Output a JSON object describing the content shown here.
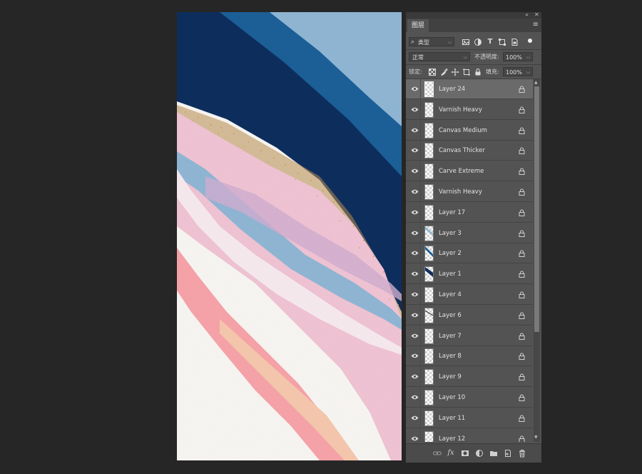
{
  "panel": {
    "collapse_glyph": "«",
    "close_glyph": "✕",
    "tab_label": "图层",
    "menu_glyph": "≡",
    "filter": {
      "value": "类型",
      "search_glyph": "⌕",
      "icons": [
        "image-filter-icon",
        "adjustment-filter-icon",
        "type-filter-icon",
        "shape-filter-icon",
        "smart-object-filter-icon",
        "filter-toggle-icon"
      ]
    },
    "blend_mode": "正常",
    "opacity_label": "不透明度:",
    "opacity_value": "100%",
    "lock_label": "锁定:",
    "fill_label": "填充:",
    "fill_value": "100%"
  },
  "layers": [
    {
      "name": "Layer 24",
      "selected": true,
      "thumb": "empty"
    },
    {
      "name": "Varnish Heavy",
      "selected": false,
      "thumb": "empty"
    },
    {
      "name": "Canvas Medium",
      "selected": false,
      "thumb": "empty"
    },
    {
      "name": "Canvas Thicker",
      "selected": false,
      "thumb": "empty"
    },
    {
      "name": "Carve Extreme",
      "selected": false,
      "thumb": "empty"
    },
    {
      "name": "Varnish Heavy",
      "selected": false,
      "thumb": "empty"
    },
    {
      "name": "Layer 17",
      "selected": false,
      "thumb": "empty"
    },
    {
      "name": "Layer 3",
      "selected": false,
      "thumb": "light-stroke"
    },
    {
      "name": "Layer 2",
      "selected": false,
      "thumb": "blue-stroke"
    },
    {
      "name": "Layer 1",
      "selected": false,
      "thumb": "navy-stroke"
    },
    {
      "name": "Layer 4",
      "selected": false,
      "thumb": "empty"
    },
    {
      "name": "Layer 6",
      "selected": false,
      "thumb": "dark-line"
    },
    {
      "name": "Layer 7",
      "selected": false,
      "thumb": "empty"
    },
    {
      "name": "Layer 8",
      "selected": false,
      "thumb": "empty"
    },
    {
      "name": "Layer 9",
      "selected": false,
      "thumb": "empty"
    },
    {
      "name": "Layer 10",
      "selected": false,
      "thumb": "empty"
    },
    {
      "name": "Layer 11",
      "selected": false,
      "thumb": "empty"
    },
    {
      "name": "Layer 12",
      "selected": false,
      "thumb": "empty"
    }
  ],
  "bottom_icons": [
    "link-icon",
    "fx-icon",
    "mask-icon",
    "adjustment-icon",
    "group-folder-icon",
    "new-layer-icon",
    "trash-icon"
  ],
  "colors": {
    "workspace": "#262626",
    "panel": "#535353",
    "selected_row": "#6a6a6a",
    "navy": "#0f2f5e",
    "blue": "#1a5f98",
    "light_blue": "#8fb6d4",
    "pink": "#efc3d3",
    "coral": "#f6a3a8",
    "peach": "#f5c7ad",
    "gold": "#b88a4e"
  }
}
